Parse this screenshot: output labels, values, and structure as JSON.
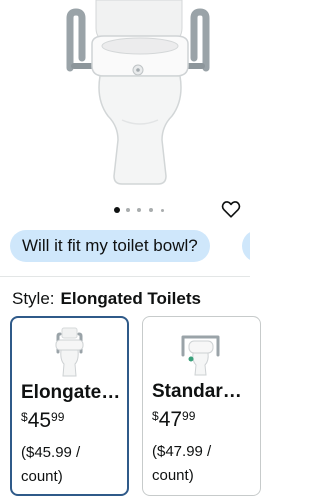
{
  "product": {
    "image_alt": "Raised toilet seat with padded arms",
    "image_dots": {
      "count": 5,
      "active_index": 0
    }
  },
  "wishlist": {
    "icon": "heart-outline-icon"
  },
  "questions": [
    {
      "label": "Will it fit my toilet bowl?"
    },
    {
      "label": ""
    }
  ],
  "style_selector": {
    "label": "Style:",
    "selected_value": "Elongated Toilets",
    "options": [
      {
        "title": "Elongated Toilets",
        "currency": "$",
        "price_whole": "45",
        "price_cents": "99",
        "unit_price": "($45.99 / count)",
        "selected": true
      },
      {
        "title": "Standard Toilets",
        "currency": "$",
        "price_whole": "47",
        "price_cents": "99",
        "unit_price": "($47.99 / count)",
        "selected": false
      }
    ]
  },
  "colors": {
    "chip_bg": "#cfe7fb",
    "selected_border": "#2f5a89",
    "text": "#0f1111"
  }
}
